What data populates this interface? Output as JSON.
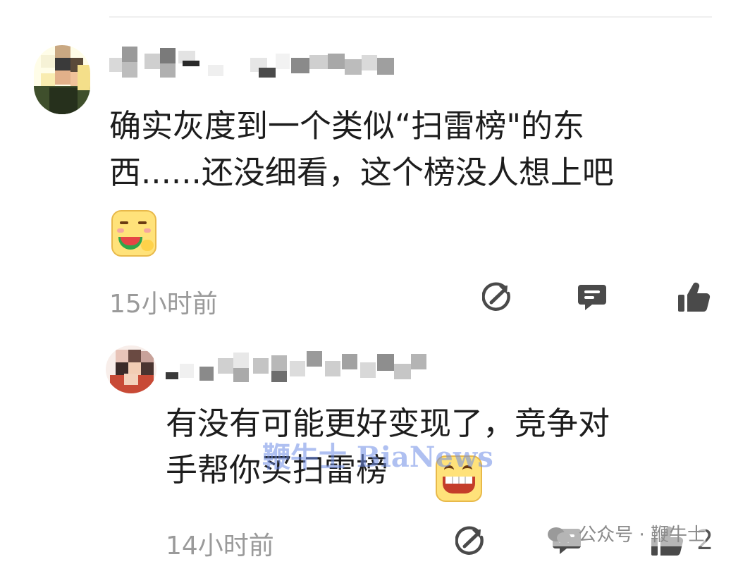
{
  "comments": [
    {
      "text_line1": "确实灰度到一个类似“扫雷榜\"的东",
      "text_line2": "西......还没细看，这个榜没人想上吧",
      "emoji": "watermelon-eating-emoji",
      "time": "15小时前"
    },
    {
      "text_line1": "有没有可能更好变现了，竞争对",
      "text_line2": "手帮你买扫雷榜",
      "emoji": "grinning-emoji",
      "time": "14小时前",
      "like_count": "2"
    }
  ],
  "watermark": "鞭牛士 BiaNews",
  "footer": {
    "label": "公众号 · 鞭牛士"
  },
  "colors": {
    "text": "#1d1d1d",
    "meta": "#9a9a9a",
    "icon": "#4a4a4a",
    "watermark": "#6e8ce6"
  }
}
